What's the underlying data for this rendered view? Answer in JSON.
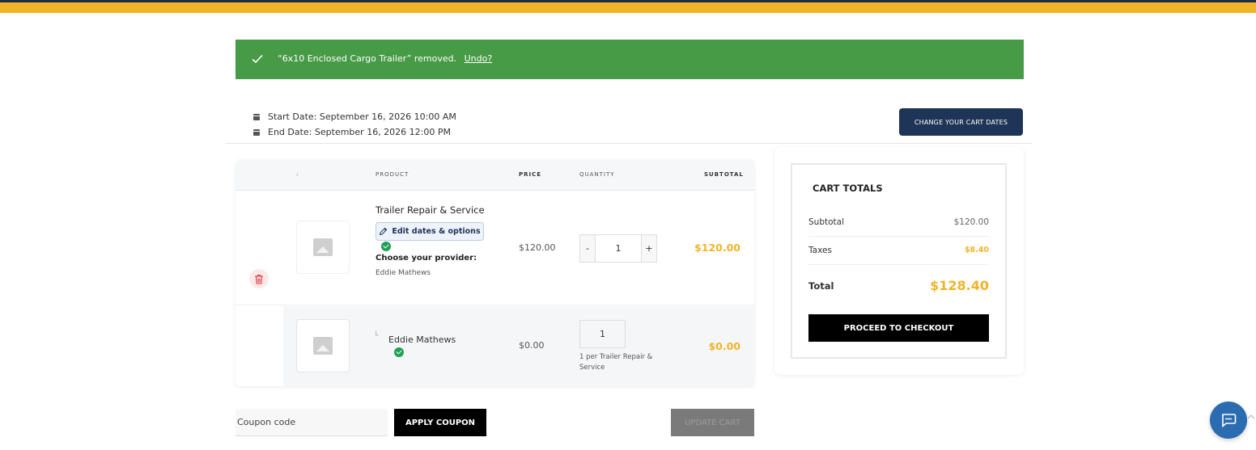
{
  "notice": {
    "message": "“6x10 Enclosed Cargo Trailer” removed.",
    "undo_label": "Undo?"
  },
  "dates": {
    "start": "Start Date: September 16, 2026 10:00 AM",
    "end": "End Date: September 16, 2026 12:00 PM",
    "change_button": "CHANGE YOUR CART DATES"
  },
  "table": {
    "headers": {
      "thumb": ":",
      "product": "PRODUCT",
      "price": "PRICE",
      "quantity": "QUANTITY",
      "subtotal": "SUBTOTAL"
    },
    "rows": [
      {
        "name": "Trailer Repair & Service",
        "edit_label": "Edit dates & options",
        "choose_label": "Choose your provider:",
        "provider": "Eddie Mathews",
        "price": "$120.00",
        "qty_minus": "-",
        "qty": "1",
        "qty_plus": "+",
        "subtotal": "$120.00"
      },
      {
        "tree_mark": "└",
        "name": "Eddie Mathews",
        "price": "$0.00",
        "qty": "1",
        "qty_note": "1 per Trailer Repair & Service",
        "subtotal": "$0.00"
      }
    ]
  },
  "coupon": {
    "placeholder": "Coupon code",
    "apply_label": "APPLY COUPON",
    "update_label": "UPDATE CART"
  },
  "totals": {
    "title": "CART TOTALS",
    "subtotal_label": "Subtotal",
    "subtotal_value": "$120.00",
    "taxes_label": "Taxes",
    "taxes_value": "$8.40",
    "total_label": "Total",
    "total_value": "$128.40",
    "checkout_label": "PROCEED TO CHECKOUT"
  },
  "colors": {
    "brand_yellow": "#f0b429",
    "navy": "#1f3557",
    "success_green": "#479a46",
    "danger_red": "#d9363e"
  },
  "icons": [
    "check-icon",
    "calendar-icon",
    "trash-icon",
    "pencil-icon",
    "image-placeholder-icon",
    "chat-icon"
  ]
}
